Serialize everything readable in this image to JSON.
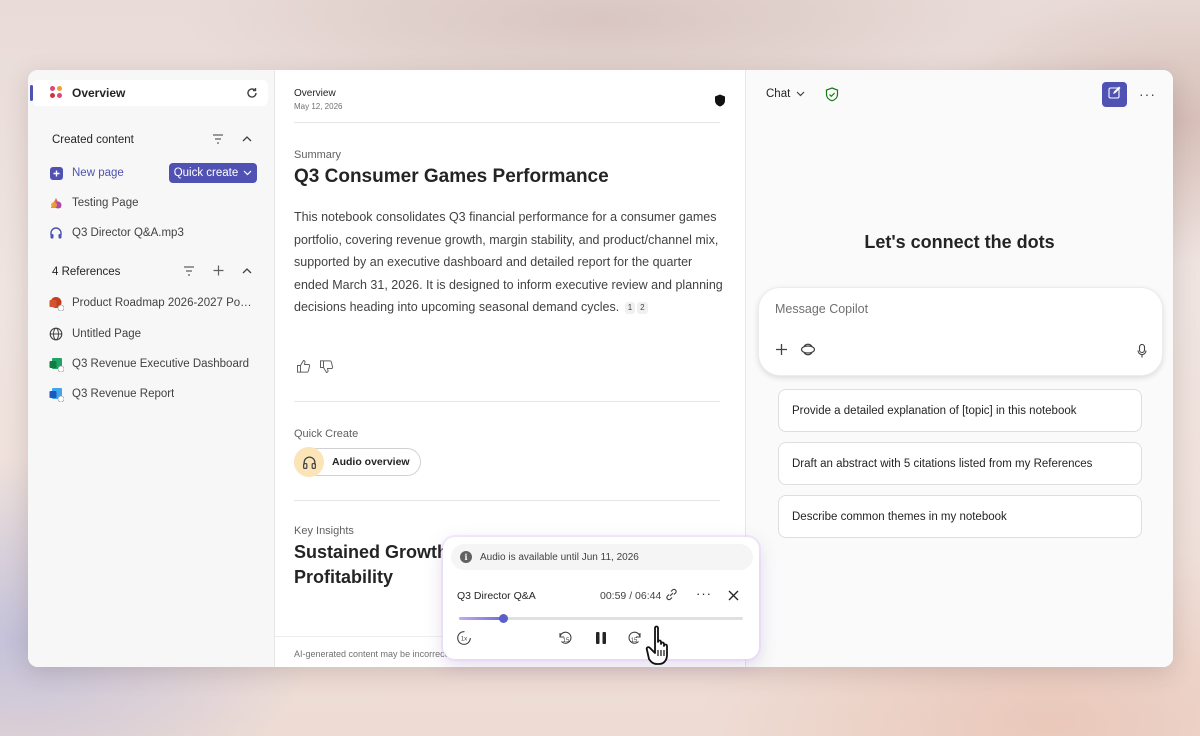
{
  "sidebar": {
    "overview_label": "Overview",
    "created_section": "Created content",
    "new_page": "New page",
    "quick_create": "Quick create",
    "created_items": [
      "Testing Page",
      "Q3 Director Q&A.mp3"
    ],
    "references_section": "4 References",
    "references": [
      {
        "label": "Product Roadmap 2026-2027 Posi...",
        "icon": "powerpoint-icon"
      },
      {
        "label": "Untitled Page",
        "icon": "globe-icon"
      },
      {
        "label": "Q3 Revenue Executive Dashboard",
        "icon": "excel-icon"
      },
      {
        "label": "Q3 Revenue Report",
        "icon": "word-icon"
      }
    ]
  },
  "main": {
    "breadcrumb": "Overview",
    "date": "May 12, 2026",
    "summary_label": "Summary",
    "title": "Q3 Consumer Games Performance",
    "summary_text": "This notebook consolidates Q3 financial performance for a consumer games portfolio, covering revenue growth, margin stability, and product/channel mix, supported by an executive dashboard and detailed report for the quarter ended March 31, 2026. It is designed to inform executive review and planning decisions heading into upcoming seasonal demand cycles.",
    "citations": [
      "1",
      "2"
    ],
    "quick_create_label": "Quick Create",
    "audio_overview": "Audio overview",
    "key_insights_label": "Key Insights",
    "insights_title": "Sustained Growth and Profitability",
    "footer": "AI-generated content may be incorrect"
  },
  "chat": {
    "mode": "Chat",
    "heading": "Let's connect the dots",
    "placeholder": "Message Copilot",
    "suggestions": [
      "Provide a detailed explanation of [topic] in this notebook",
      "Draft an abstract with 5 citations listed from my References",
      "Describe common themes in my notebook"
    ]
  },
  "audio_player": {
    "availability": "Audio is available until Jun 11, 2026",
    "title": "Q3 Director Q&A",
    "time": "00:59 / 06:44",
    "progress": 0.154,
    "skip_back": "15",
    "skip_forward": "15",
    "speed": "1x"
  },
  "colors": {
    "accent": "#4f52b2",
    "audio_circle": "#fbe4b8"
  }
}
